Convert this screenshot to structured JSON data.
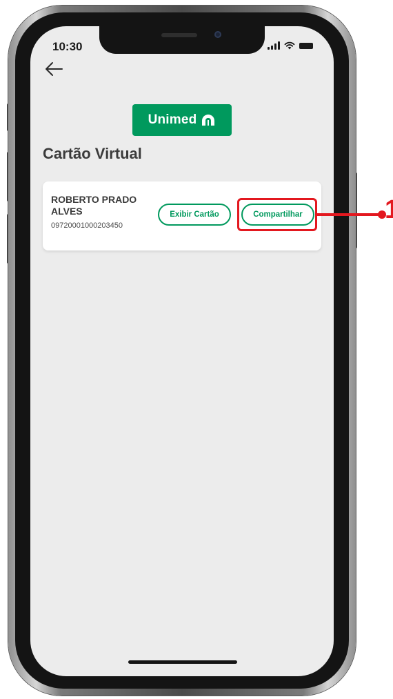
{
  "status_bar": {
    "time": "10:30"
  },
  "navigation": {
    "back_icon": "arrow-left-icon"
  },
  "logo": {
    "text": "Unimed",
    "icon": "unimed-tree-icon",
    "brand_color": "#00995d"
  },
  "page": {
    "title": "Cartão Virtual"
  },
  "card": {
    "holder_name_line1": "ROBERTO PRADO",
    "holder_name_line2": "ALVES",
    "card_number": "09720001000203450",
    "view_button_label": "Exibir Cartão",
    "share_button_label": "Compartilhar"
  },
  "annotation": {
    "callout_number": "1",
    "highlight_color": "#e3181f"
  }
}
